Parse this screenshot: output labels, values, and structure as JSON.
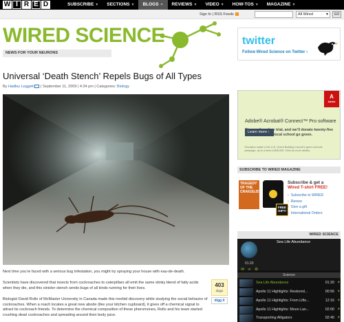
{
  "nav": {
    "logo_letters": [
      "W",
      "I",
      "R",
      "E",
      "D"
    ],
    "items": [
      {
        "label": "SUBSCRIBE",
        "has_menu": true
      },
      {
        "label": "SECTIONS",
        "has_menu": true
      },
      {
        "label": "BLOGS",
        "has_menu": true,
        "active": true
      },
      {
        "label": "REVIEWS",
        "has_menu": true
      },
      {
        "label": "VIDEO",
        "has_menu": true
      },
      {
        "label": "HOW-TOS",
        "has_menu": true
      },
      {
        "label": "MAGAZINE",
        "has_menu": true
      }
    ]
  },
  "subbar": {
    "signin": "Sign In",
    "rss": "RSS Feeds",
    "search_scope": "All Wired",
    "go": "GO"
  },
  "blog": {
    "title": "WIRED SCIENCE",
    "tagline": "NEWS FOR YOUR NEURONS"
  },
  "twitter": {
    "logo_text": "twitter",
    "follow": "Follow Wired Science on Twitter ›"
  },
  "article": {
    "headline": "Universal ‘Death Stench’ Repels Bugs of All Types",
    "by": "By",
    "author": "Hadley Leggett",
    "date": "September 11, 2009",
    "time": "4:34 pm",
    "categories_label": "Categories:",
    "category": "Biology",
    "paragraphs": [
      "Next time you’re faced with a serious bug infestation, you might try spraying your house with eau-de-death.",
      "Scientists have discovered that insects from cockroaches to caterpillars all emit the same stinky blend of fatty acids when they die, and this sinister stench sends bugs of all kinds running for their lives.",
      "Biologist David Rollo of McMaster University in Canada made this morbid discovery while studying the social behavior of cockroaches. When a roach locates a great new abode (like your kitchen cupboard), it gives off a chemical signal to attract its cockroach friends. To determine the chemical composition of these pheromones, Rollo and his team started crushing dead cockroaches and spreading around their body juice."
    ],
    "digg_count": "403",
    "digg_label": "diggs",
    "digg_button": "digg it"
  },
  "adobe_ad": {
    "brand": "Adobe",
    "title": "Adobe® Acrobat® Connect™ Pro software",
    "body": "Sign up for a free trial, and we’ll donate twenty-five dollars to help a local school go green.",
    "button": "Learn more ›",
    "fine_print": "*Donation made to the U.S. Green Building Council’s green schools campaign, up to a total of $25,000. Click for more details."
  },
  "subscribe": {
    "header": "SUBSCRIBE TO WIRED MAGAZINE",
    "title_line1": "Subscribe & get a",
    "title_line2": "Wired T-shirt FREE!",
    "cover_text": "TRAGEDY OF THE CRAIGSLIST",
    "free_gift": "FREE GIFT!",
    "links": [
      "Subscribe to WIRED",
      "Renew",
      "Give a gift",
      "International Orders"
    ]
  },
  "player": {
    "header": "WIRED SCIENCE",
    "now_playing": "Sea Life Abundance",
    "now_time": "01:20",
    "tab": "Science",
    "videos": [
      {
        "title": "Sea Life Abundance",
        "duration": "01:20",
        "active": true
      },
      {
        "title": "Apollo 11 Highlights: Restored...",
        "duration": "00:56"
      },
      {
        "title": "Apollo 11 Highlights: From Lifto...",
        "duration": "12:16"
      },
      {
        "title": "Apollo 11 Highlights: Moon Lan...",
        "duration": "02:00"
      },
      {
        "title": "Transporting  Alligators",
        "duration": "02:40"
      }
    ]
  },
  "colors": {
    "brand_green": "#8ab92d",
    "twitter_blue": "#33bfe8",
    "link_blue": "#2b6fb5",
    "adobe_red": "#cc1111"
  }
}
